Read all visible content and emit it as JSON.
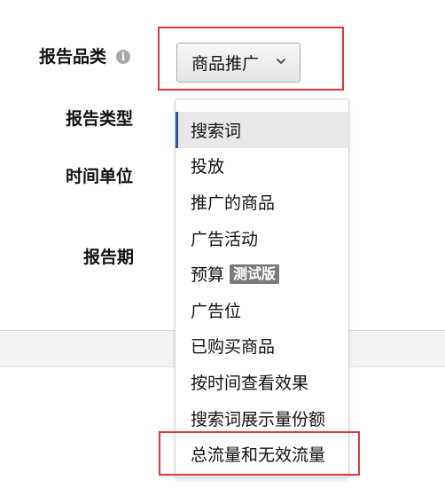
{
  "form": {
    "category_label": "报告品类",
    "type_label": "报告类型",
    "time_unit_label": "时间单位",
    "period_label": "报告期",
    "info_icon": "i"
  },
  "category_dropdown": {
    "selected": "商品推广",
    "icon": "chevron-down-icon"
  },
  "report_type_menu": {
    "items": [
      {
        "label": "搜索词",
        "selected": true
      },
      {
        "label": "投放"
      },
      {
        "label": "推广的商品"
      },
      {
        "label": "广告活动"
      },
      {
        "label": "预算",
        "badge": "测试版"
      },
      {
        "label": "广告位"
      },
      {
        "label": "已购买商品"
      },
      {
        "label": "按时间查看效果"
      },
      {
        "label": "搜索词展示量份额"
      },
      {
        "label": "总流量和无效流量"
      }
    ]
  },
  "colors": {
    "highlight": "#e2353a",
    "selected_indicator": "#2c5a8f",
    "badge_bg": "#7b7b7b"
  }
}
